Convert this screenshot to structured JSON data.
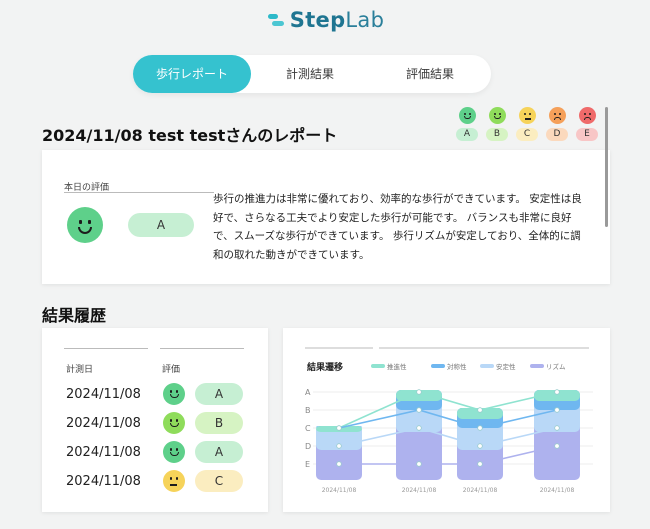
{
  "app": {
    "brand_prefix": "Step",
    "brand_suffix": "Lab",
    "logo_icon": "steplab-logo-icon"
  },
  "tabs": [
    {
      "label": "歩行レポート",
      "active": true
    },
    {
      "label": "計測結果",
      "active": false
    },
    {
      "label": "評価結果",
      "active": false
    }
  ],
  "report": {
    "title": "2024/11/08 test testさんのレポート"
  },
  "grade_legend": [
    {
      "grade": "A",
      "face_color": "#5ed08a",
      "tag_color": "#c6efd3",
      "icon": "smile-face-icon"
    },
    {
      "grade": "B",
      "face_color": "#8fdc5b",
      "tag_color": "#d6f3c3",
      "icon": "smile-face-icon"
    },
    {
      "grade": "C",
      "face_color": "#f6d35a",
      "tag_color": "#fbedc0",
      "icon": "neutral-face-icon"
    },
    {
      "grade": "D",
      "face_color": "#f5a05a",
      "tag_color": "#fbd9bd",
      "icon": "frown-face-icon"
    },
    {
      "grade": "E",
      "face_color": "#ef6a6a",
      "tag_color": "#f8c6c6",
      "icon": "sad-face-icon"
    }
  ],
  "today": {
    "label": "本日の評価",
    "grade": "A",
    "description": "歩行の推進力は非常に優れており、効率的な歩行ができています。 安定性は良好で、さらなる工夫でより安定した歩行が可能です。 バランスも非常に良好で、スムーズな歩行ができています。 歩行リズムが安定しており、全体的に調和の取れた動きができています。"
  },
  "history": {
    "title": "結果履歴",
    "col_date": "計測日",
    "col_grade": "評価",
    "rows": [
      {
        "date": "2024/11/08",
        "grade": "A",
        "face_color": "#5ed08a",
        "pill_color": "#c6efd3"
      },
      {
        "date": "2024/11/08",
        "grade": "B",
        "face_color": "#8fdc5b",
        "pill_color": "#d6f3c3"
      },
      {
        "date": "2024/11/08",
        "grade": "A",
        "face_color": "#5ed08a",
        "pill_color": "#c6efd3"
      },
      {
        "date": "2024/11/08",
        "grade": "C",
        "face_color": "#f6d35a",
        "pill_color": "#fbedc0"
      }
    ]
  },
  "chart_data": {
    "type": "area",
    "title": "結果遷移",
    "y_categories": [
      "A",
      "B",
      "C",
      "D",
      "E"
    ],
    "x": [
      "2024/11/08",
      "2024/11/08",
      "2024/11/08",
      "2024/11/08"
    ],
    "series": [
      {
        "name": "推進性",
        "color": "#8fe3d0",
        "values": [
          "C",
          "A",
          "B",
          "A"
        ]
      },
      {
        "name": "対称性",
        "color": "#6fb7f0",
        "values": [
          "C",
          "B",
          "C",
          "B"
        ]
      },
      {
        "name": "安定性",
        "color": "#b9d8f7",
        "values": [
          "D",
          "C",
          "D",
          "C"
        ]
      },
      {
        "name": "リズム",
        "color": "#aeb2ee",
        "values": [
          "E",
          "E",
          "E",
          "D"
        ]
      }
    ],
    "legend": "top"
  }
}
